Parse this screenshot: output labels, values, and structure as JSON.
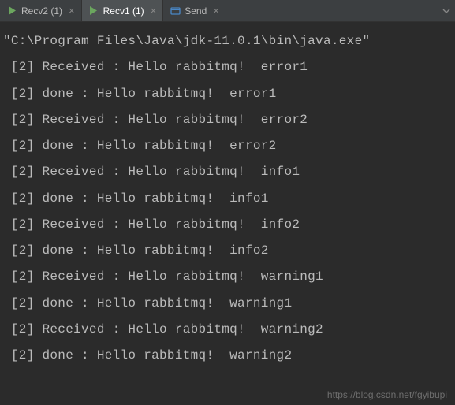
{
  "tabs": [
    {
      "label": "Recv2 (1)",
      "active": false,
      "icon_color": "#6ba65e"
    },
    {
      "label": "Recv1 (1)",
      "active": true,
      "icon_color": "#6ba65e"
    },
    {
      "label": "Send",
      "active": false,
      "icon_color": "#4a88c7"
    }
  ],
  "console": {
    "command": "\"C:\\Program Files\\Java\\jdk-11.0.1\\bin\\java.exe\"",
    "lines": [
      " [2] Received : Hello rabbitmq!  error1",
      " [2] done : Hello rabbitmq!  error1",
      " [2] Received : Hello rabbitmq!  error2",
      " [2] done : Hello rabbitmq!  error2",
      " [2] Received : Hello rabbitmq!  info1",
      " [2] done : Hello rabbitmq!  info1",
      " [2] Received : Hello rabbitmq!  info2",
      " [2] done : Hello rabbitmq!  info2",
      " [2] Received : Hello rabbitmq!  warning1",
      " [2] done : Hello rabbitmq!  warning1",
      " [2] Received : Hello rabbitmq!  warning2",
      " [2] done : Hello rabbitmq!  warning2"
    ]
  },
  "watermark": "https://blog.csdn.net/fgyibupi"
}
